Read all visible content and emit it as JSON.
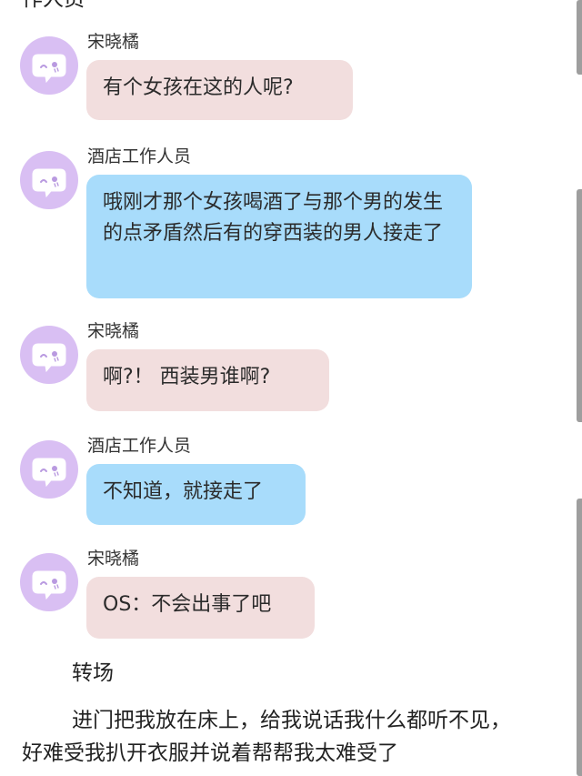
{
  "top_text": "作人员",
  "messages": [
    {
      "sender": "宋晓橘",
      "text": "有个女孩在这的人呢?",
      "role": "customer"
    },
    {
      "sender": "酒店工作人员",
      "text": "哦刚才那个女孩喝酒了与那个男的发生的点矛盾然后有的穿西装的男人接走了",
      "role": "staff"
    },
    {
      "sender": "宋晓橘",
      "text": "啊?！ 西装男谁啊?",
      "role": "customer"
    },
    {
      "sender": "酒店工作人员",
      "text": "不知道，就接走了",
      "role": "staff"
    },
    {
      "sender": "宋晓橘",
      "text": "OS：不会出事了吧",
      "role": "customer"
    }
  ],
  "scene_label": "转场",
  "paragraph": "进门把我放在床上，给我说话我什么都听不见，好难受我扒开衣服并说着帮帮我太难受了",
  "colors": {
    "avatar_bg": "#d9bff3",
    "customer_bubble": "#f2dede",
    "staff_bubble": "#a8dcfb",
    "scrollbar": "#9e9e9e"
  },
  "icons": {
    "avatar": "chat-bubble-face-icon"
  }
}
